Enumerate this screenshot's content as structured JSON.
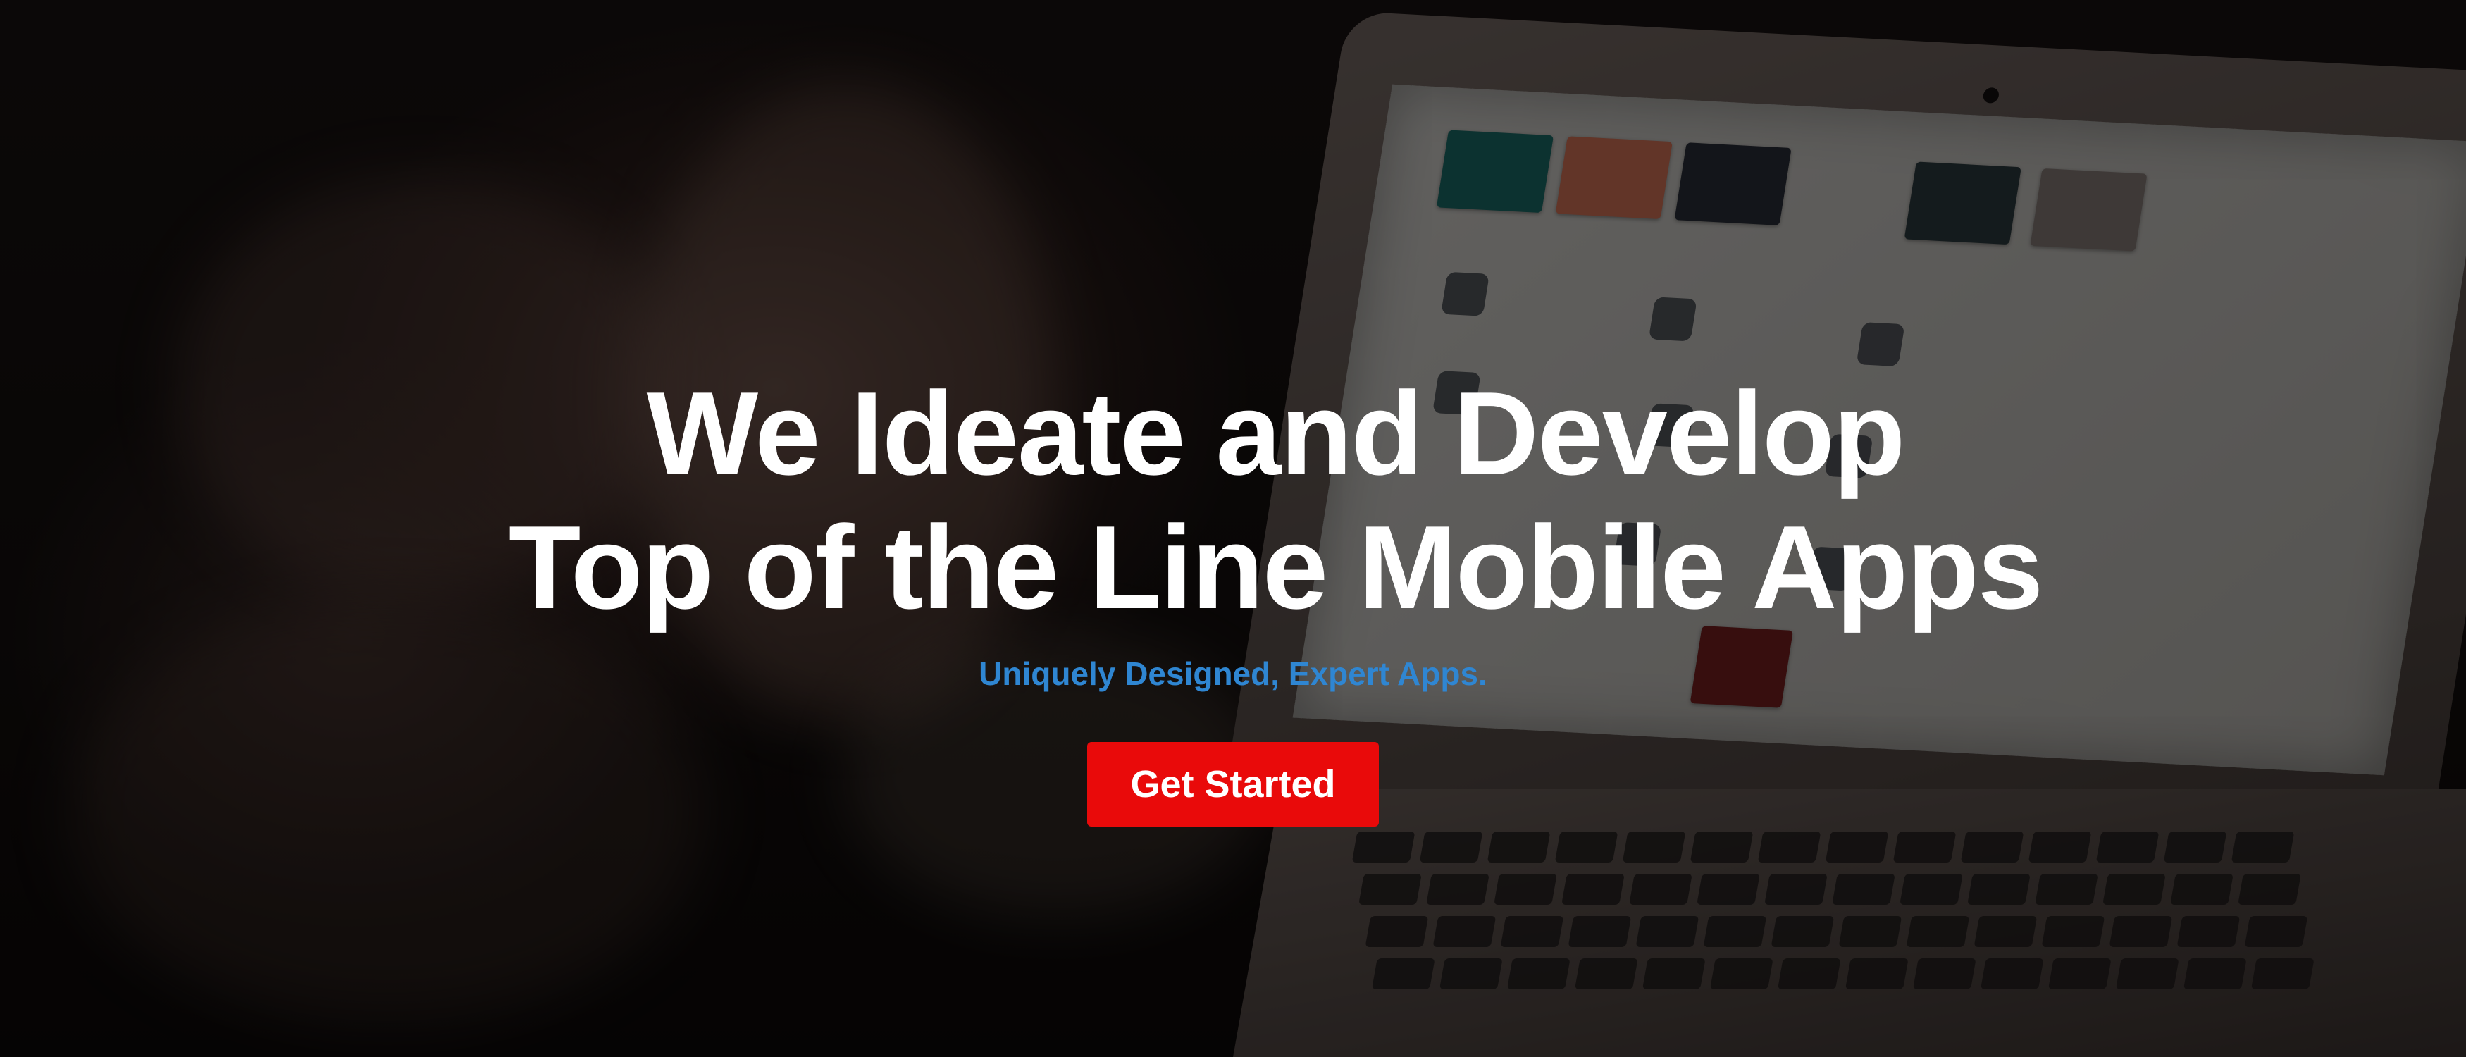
{
  "hero": {
    "headline_line1": "We Ideate and Develop",
    "headline_line2": "Top of the Line Mobile Apps",
    "subtitle": "Uniquely Designed, Expert Apps.",
    "cta_label": "Get Started"
  },
  "colors": {
    "headline": "#ffffff",
    "subtitle": "#2f86d2",
    "cta_background": "#e90a0a",
    "cta_text": "#ffffff",
    "overlay": "rgba(0,0,0,0.55)"
  }
}
